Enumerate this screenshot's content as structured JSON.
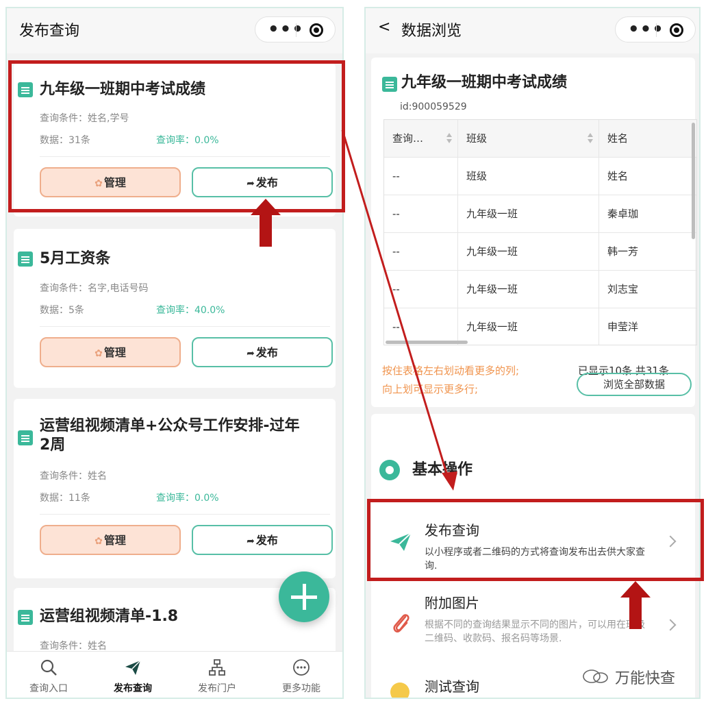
{
  "left": {
    "title": "发布查询",
    "cards": [
      {
        "title": "九年级一班期中考试成绩",
        "conditions": "查询条件：姓名,学号",
        "data": "数据：31条",
        "rate": "查询率：0.0%"
      },
      {
        "title": "5月工资条",
        "conditions": "查询条件：名字,电话号码",
        "data": "数据：5条",
        "rate": "查询率：40.0%"
      },
      {
        "title_line1": "运营组视频清单+公众号工作安排-过年",
        "title_line2": "2周",
        "conditions": "查询条件：姓名",
        "data": "数据：11条",
        "rate": "查询率：0.0%"
      },
      {
        "title": "运营组视频清单-1.8",
        "conditions": "查询条件：姓名"
      }
    ],
    "manage_label": "管理",
    "publish_label": "发布",
    "tabs": [
      "查询入口",
      "发布查询",
      "发布门户",
      "更多功能"
    ]
  },
  "right": {
    "back_label": "<",
    "title": "数据浏览",
    "dataset_title": "九年级一班期中考试成绩",
    "dataset_id": "id:900059529",
    "table": {
      "headers": [
        "查询…",
        "班级",
        "姓名"
      ],
      "rows": [
        [
          "--",
          "班级",
          "姓名"
        ],
        [
          "--",
          "九年级一班",
          "秦卓珈"
        ],
        [
          "--",
          "九年级一班",
          "韩一芳"
        ],
        [
          "--",
          "九年级一班",
          "刘志宝"
        ],
        [
          "--",
          "九年级一班",
          "申莹洋"
        ]
      ]
    },
    "hint_line1": "按住表格左右划动看更多的列;",
    "hint_line2": "向上划可显示更多行;",
    "count": "已显示10条 共31条",
    "browse_all": "浏览全部数据",
    "section_title": "基本操作",
    "menu": [
      {
        "title": "发布查询",
        "desc": "以小程序或者二维码的方式将查询发布出去供大家查询."
      },
      {
        "title": "附加图片",
        "desc": "根据不同的查询结果显示不同的图片，可以用在班级二维码、收款码、报名码等场景."
      },
      {
        "title": "测试查询",
        "desc": ""
      }
    ]
  },
  "watermark": "万能快查",
  "colors": {
    "accent": "#3bb89a",
    "annotation": "#c21d1d",
    "hint": "#f0944e",
    "manage_bg": "#fde3d6"
  }
}
